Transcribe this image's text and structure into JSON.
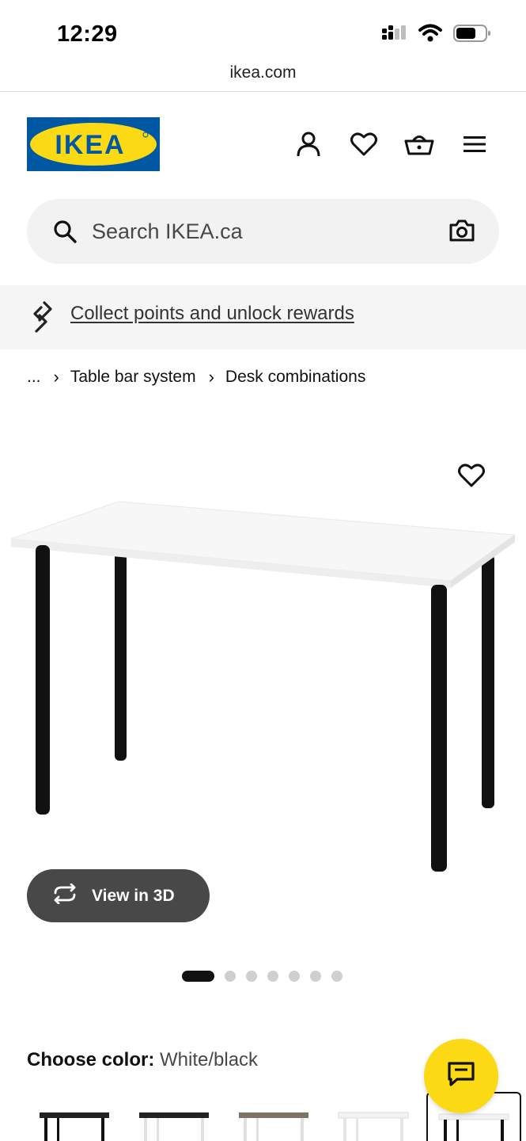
{
  "status_bar": {
    "time": "12:29"
  },
  "browser": {
    "url": "ikea.com"
  },
  "header": {
    "logo_text": "IKEA",
    "icons": [
      "profile-icon",
      "heart-icon",
      "shopping-basket-icon",
      "hamburger-menu-icon"
    ]
  },
  "search": {
    "placeholder": "Search IKEA.ca",
    "value": ""
  },
  "rewards": {
    "link_text": "Collect points and unlock rewards"
  },
  "breadcrumb": {
    "items": [
      "...",
      "Table bar system",
      "Desk combinations"
    ]
  },
  "product": {
    "view_3d_label": "View in 3D",
    "image_count": 7,
    "active_image_index": 0
  },
  "color_selector": {
    "label": "Choose color:",
    "selected_value": "White/black",
    "options": [
      "black-brown/black",
      "black/white",
      "grey/white",
      "white/white",
      "white/black"
    ]
  },
  "colors": {
    "ikea_blue": "#0058a3",
    "ikea_yellow": "#fbd914",
    "button_dark": "#484848"
  }
}
